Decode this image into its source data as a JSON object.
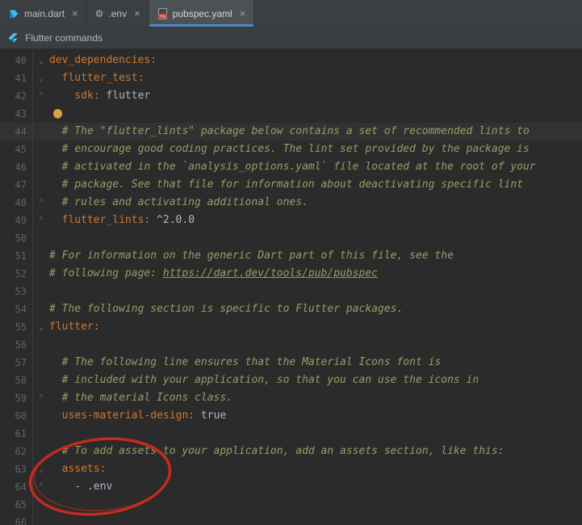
{
  "tabs": [
    {
      "label": "main.dart",
      "close": "×",
      "icon": "dart-file-icon"
    },
    {
      "label": ".env",
      "close": "×",
      "icon": "env-file-icon"
    },
    {
      "label": "pubspec.yaml",
      "close": "×",
      "icon": "yaml-file-icon",
      "active": true
    }
  ],
  "banner": {
    "label": "Flutter commands",
    "icon": "flutter-icon"
  },
  "colors": {
    "tab_underline": "#4A88C7",
    "key": "#CC7832",
    "plain": "#A9B7C6",
    "comment": "#9A9C67",
    "line_number": "#606366",
    "bulb": "#D9A440",
    "annotation": "#CB2C1D"
  },
  "editor": {
    "lines": [
      {
        "num": 40,
        "fold": "start",
        "segments": [
          {
            "t": "dev_dependencies:",
            "c": "key"
          }
        ]
      },
      {
        "num": 41,
        "fold": "start",
        "segments": [
          {
            "t": "  ",
            "c": "plain"
          },
          {
            "t": "flutter_test:",
            "c": "key"
          }
        ]
      },
      {
        "num": 42,
        "fold": "end",
        "segments": [
          {
            "t": "    ",
            "c": "plain"
          },
          {
            "t": "sdk:",
            "c": "key"
          },
          {
            "t": " flutter",
            "c": "plain"
          }
        ]
      },
      {
        "num": 43,
        "bulb": true,
        "segments": []
      },
      {
        "num": 44,
        "highlight": true,
        "segments": [
          {
            "t": "  # The \"flutter_lints\" package below contains a set of recommended lints to",
            "c": "comment"
          }
        ]
      },
      {
        "num": 45,
        "segments": [
          {
            "t": "  # encourage good coding practices. The lint set provided by the package is",
            "c": "comment"
          }
        ]
      },
      {
        "num": 46,
        "segments": [
          {
            "t": "  # activated in the `analysis_options.yaml` file located at the root of your",
            "c": "comment"
          }
        ]
      },
      {
        "num": 47,
        "segments": [
          {
            "t": "  # package. See that file for information about deactivating specific lint",
            "c": "comment"
          }
        ]
      },
      {
        "num": 48,
        "fold": "end",
        "segments": [
          {
            "t": "  # rules and activating additional ones.",
            "c": "comment"
          }
        ]
      },
      {
        "num": 49,
        "fold": "end",
        "segments": [
          {
            "t": "  ",
            "c": "plain"
          },
          {
            "t": "flutter_lints:",
            "c": "key"
          },
          {
            "t": " ^2.0.0",
            "c": "plain"
          }
        ]
      },
      {
        "num": 50,
        "segments": []
      },
      {
        "num": 51,
        "segments": [
          {
            "t": "# For information on the generic Dart part of this file, see the",
            "c": "comment"
          }
        ]
      },
      {
        "num": 52,
        "segments": [
          {
            "t": "# following page: ",
            "c": "comment"
          },
          {
            "t": "https://dart.dev/tools/pub/pubspec",
            "c": "url"
          }
        ]
      },
      {
        "num": 53,
        "segments": []
      },
      {
        "num": 54,
        "segments": [
          {
            "t": "# The following section is specific to Flutter packages.",
            "c": "comment"
          }
        ]
      },
      {
        "num": 55,
        "fold": "start",
        "segments": [
          {
            "t": "flutter:",
            "c": "key"
          }
        ]
      },
      {
        "num": 56,
        "segments": []
      },
      {
        "num": 57,
        "segments": [
          {
            "t": "  # The following line ensures that the Material Icons font is",
            "c": "comment"
          }
        ]
      },
      {
        "num": 58,
        "segments": [
          {
            "t": "  # included with your application, so that you can use the icons in",
            "c": "comment"
          }
        ]
      },
      {
        "num": 59,
        "fold": "end",
        "segments": [
          {
            "t": "  # the material Icons class.",
            "c": "comment"
          }
        ]
      },
      {
        "num": 60,
        "segments": [
          {
            "t": "  ",
            "c": "plain"
          },
          {
            "t": "uses-material-design:",
            "c": "key"
          },
          {
            "t": " true",
            "c": "plain"
          }
        ]
      },
      {
        "num": 61,
        "segments": []
      },
      {
        "num": 62,
        "segments": [
          {
            "t": "  # To add assets to your application, add an assets section, like this:",
            "c": "comment"
          }
        ]
      },
      {
        "num": 63,
        "fold": "start",
        "segments": [
          {
            "t": "  ",
            "c": "plain"
          },
          {
            "t": "assets:",
            "c": "key"
          }
        ]
      },
      {
        "num": 64,
        "fold": "end",
        "segments": [
          {
            "t": "    - .env",
            "c": "plain"
          }
        ]
      },
      {
        "num": 65,
        "segments": []
      },
      {
        "num": 66,
        "segments": []
      }
    ]
  },
  "annotation": {
    "shape": "hand-drawn red ellipse circling the assets section (lines 62-64)"
  }
}
